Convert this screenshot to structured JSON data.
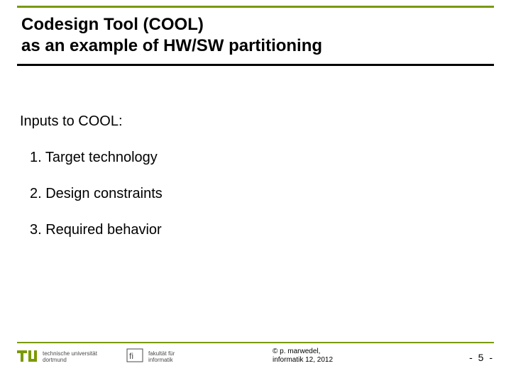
{
  "title": {
    "line1": "Codesign Tool (COOL)",
    "line2": "as an example of HW/SW partitioning"
  },
  "body": {
    "intro": "Inputs to COOL:",
    "items": [
      "1. Target technology",
      "2. Design constraints",
      "3. Required behavior"
    ]
  },
  "footer": {
    "logo1": {
      "line1": "technische universität",
      "line2": "dortmund"
    },
    "logo2": {
      "line1": "fakultät für",
      "line2": "informatik"
    },
    "copyright": {
      "line1": "©  p. marwedel,",
      "line2": "informatik 12,  2012"
    },
    "page": "-  5 -"
  },
  "colors": {
    "accent": "#7a9a01"
  }
}
